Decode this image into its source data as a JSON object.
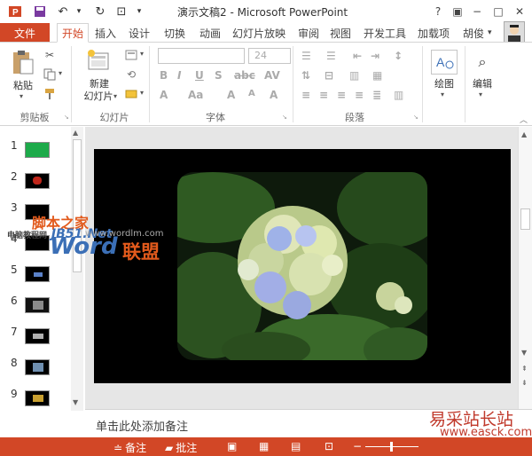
{
  "titlebar": {
    "title": "演示文稿2 - Microsoft PowerPoint",
    "window_controls": [
      "?",
      "▣",
      "−",
      "□",
      "✕"
    ]
  },
  "tabs": {
    "file": "文件",
    "items": [
      "开始",
      "插入",
      "设计",
      "切换",
      "动画",
      "幻灯片放映",
      "审阅",
      "视图",
      "开发工具",
      "加载项"
    ],
    "active": "开始",
    "user": "胡俊"
  },
  "ribbon": {
    "clipboard": {
      "paste": "粘贴",
      "label": "剪贴板"
    },
    "slides": {
      "new_slide_line1": "新建",
      "new_slide_line2": "幻灯片",
      "label": "幻灯片"
    },
    "font": {
      "size": "24",
      "label": "字体"
    },
    "paragraph": {
      "label": "段落"
    },
    "drawing": {
      "label": "绘图"
    },
    "editing": {
      "label": "编辑"
    }
  },
  "thumbnails": {
    "numbers": [
      "1",
      "2",
      "3",
      "4",
      "5",
      "6",
      "7",
      "8",
      "9"
    ]
  },
  "notes": {
    "placeholder": "单击此处添加备注"
  },
  "statusbar": {
    "notes": "备注",
    "comments": "批注"
  },
  "watermarks": {
    "site1": "脚本之家",
    "site1_sub": "JB51.Net",
    "site1_sub_left": "电脑教程网",
    "site2_brand": "Word",
    "site2_cn": "联盟",
    "site2_url": "www.wordlm.com",
    "site3": "易采站长站",
    "site3_url": "www.easck.com"
  },
  "colors": {
    "accent": "#d24726",
    "status_bar": "#d24726"
  }
}
